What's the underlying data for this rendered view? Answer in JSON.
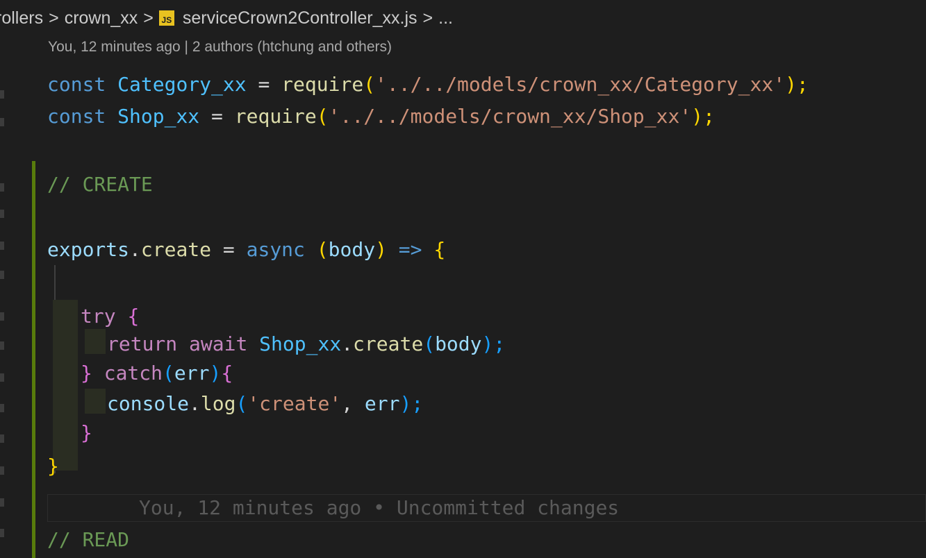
{
  "breadcrumb": {
    "segments": [
      "rollers",
      "crown_xx",
      "serviceCrown2Controller_xx.js",
      "..."
    ],
    "separator": ">",
    "file_icon_label": "JS"
  },
  "codelens": {
    "text": "You, 12 minutes ago | 2 authors (htchung and others)"
  },
  "code": {
    "line1": {
      "const": "const",
      "name": "Category_xx",
      "eq": " = ",
      "require": "require",
      "open": "(",
      "path": "'../../models/crown_xx/Category_xx'",
      "close": ");"
    },
    "line2": {
      "const": "const",
      "name": "Shop_xx",
      "eq": " = ",
      "require": "require",
      "open": "(",
      "path": "'../../models/crown_xx/Shop_xx'",
      "close": ");"
    },
    "comment_create": "// CREATE",
    "line_exports": {
      "exports": "exports",
      "dot": ".",
      "create": "create",
      "eq": " = ",
      "async": "async",
      "lparen": "(",
      "body": "body",
      "rparen": ")",
      "arrow": "=>",
      "lbrace": "{"
    },
    "line_try": {
      "try": "try",
      "lbrace": "{"
    },
    "line_return": {
      "return": "return",
      "await": "await",
      "shop": "Shop_xx",
      "dot": ".",
      "create": "create",
      "lparen": "(",
      "body": "body",
      "rparen": ");"
    },
    "line_catch": {
      "rbrace": "}",
      "catch": "catch",
      "lparen": "(",
      "err": "err",
      "rparen": ")",
      "lbrace": "{"
    },
    "line_log": {
      "console": "console",
      "dot": ".",
      "log": "log",
      "lparen": "(",
      "str": "'create'",
      "comma": ", ",
      "err": "err",
      "rparen": ");"
    },
    "line_close_inner": "}",
    "line_close_outer": "}",
    "comment_read": "// READ"
  },
  "blame": {
    "text": "You, 12 minutes ago • Uncommitted changes"
  },
  "colors": {
    "background": "#1e1e1e",
    "keyword": "#569cd6",
    "constant": "#4fc1ff",
    "function": "#dcdcaa",
    "string": "#ce9178",
    "comment": "#6a9955",
    "parameter": "#9cdcfe",
    "control": "#c586c0",
    "gutter_modified": "#587c0c",
    "js_icon": "#e8c220"
  }
}
